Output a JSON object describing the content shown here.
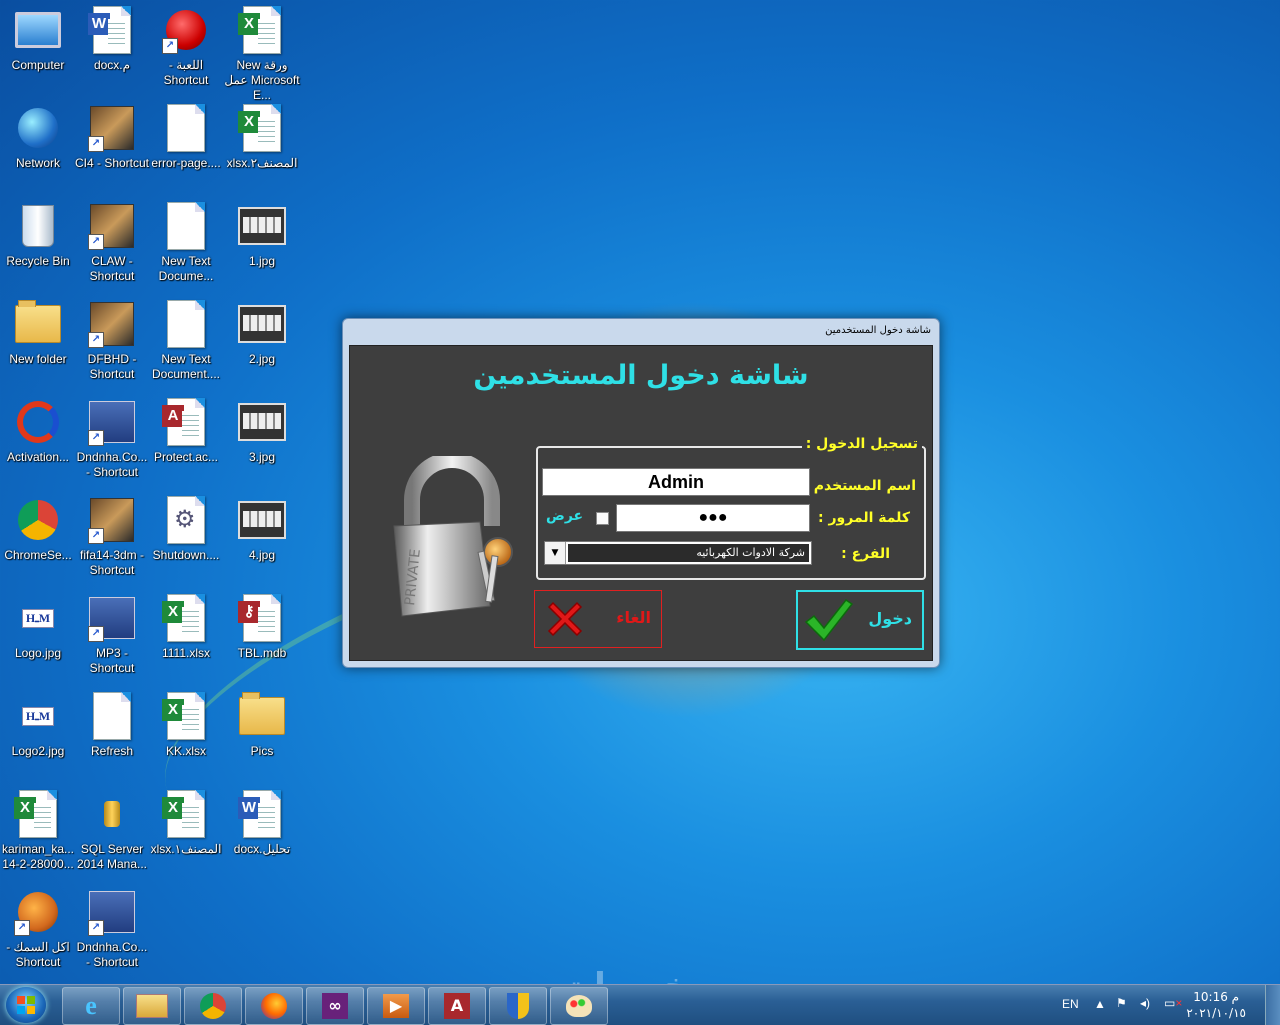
{
  "desktop_icons": [
    {
      "label": "Computer",
      "icon": "computer-icon"
    },
    {
      "label": "م.docx",
      "icon": "word-doc-icon"
    },
    {
      "label": "اللعبة - Shortcut",
      "icon": "red-creature-game-icon"
    },
    {
      "label": "New ورقة عمل Microsoft E...",
      "icon": "excel-icon"
    },
    {
      "label": "Network",
      "icon": "network-globe-icon"
    },
    {
      "label": "CI4 - Shortcut",
      "icon": "game-art-icon"
    },
    {
      "label": "error-page....",
      "icon": "blank-doc-icon"
    },
    {
      "label": "المصنف٢.xlsx",
      "icon": "excel-icon"
    },
    {
      "label": "Recycle Bin",
      "icon": "recycle-bin-icon"
    },
    {
      "label": "CLAW - Shortcut",
      "icon": "claw-game-icon"
    },
    {
      "label": "New Text Docume...",
      "icon": "text-doc-icon"
    },
    {
      "label": "1.jpg",
      "icon": "jpg-thumbnail-icon"
    },
    {
      "label": "New folder",
      "icon": "folder-icon"
    },
    {
      "label": "DFBHD - Shortcut",
      "icon": "soldier-game-icon"
    },
    {
      "label": "New Text Document....",
      "icon": "text-doc-icon"
    },
    {
      "label": "2.jpg",
      "icon": "jpg-thumbnail-icon"
    },
    {
      "label": "Activation...",
      "icon": "activation-swirl-icon"
    },
    {
      "label": "Dndnha.Co... - Shortcut",
      "icon": "dndnha-shortcut-icon"
    },
    {
      "label": "Protect.ac...",
      "icon": "access-doc-icon"
    },
    {
      "label": "3.jpg",
      "icon": "jpg-thumbnail-icon"
    },
    {
      "label": "ChromeSe...",
      "icon": "chrome-setup-icon"
    },
    {
      "label": "fifa14-3dm - Shortcut",
      "icon": "fifa-game-icon"
    },
    {
      "label": "Shutdown....",
      "icon": "gear-doc-icon"
    },
    {
      "label": "4.jpg",
      "icon": "jpg-thumbnail-icon"
    },
    {
      "label": "Logo.jpg",
      "icon": "logo-image-icon"
    },
    {
      "label": "MP3 - Shortcut",
      "icon": "mp3-book-icon"
    },
    {
      "label": "1111.xlsx",
      "icon": "excel-icon"
    },
    {
      "label": "TBL.mdb",
      "icon": "mdb-doc-icon"
    },
    {
      "label": "Logo2.jpg",
      "icon": "logo-image-icon"
    },
    {
      "label": "Refresh",
      "icon": "refresh-doc-icon"
    },
    {
      "label": "KK.xlsx",
      "icon": "excel-icon"
    },
    {
      "label": "Pics",
      "icon": "folder-icon"
    },
    {
      "label": "kariman_ka... 14-2-28000...",
      "icon": "excel-icon"
    },
    {
      "label": "SQL Server 2014 Mana...",
      "icon": "sql-server-icon"
    },
    {
      "label": "المصنف١.xlsx",
      "icon": "excel-icon"
    },
    {
      "label": "تحليل.docx",
      "icon": "word-doc-icon"
    },
    {
      "label": "اكل السمك - Shortcut",
      "icon": "fish-game-icon"
    },
    {
      "label": "Dndnha.Co... - Shortcut",
      "icon": "dndnha-shortcut-icon"
    }
  ],
  "dialog": {
    "title": "شاشة دخول المستخدمين",
    "heading": "شاشة دخول المستخدمين",
    "group_caption": "تسجيل الدخول :",
    "username_label": "اسم المستخدم :",
    "username_value": "Admin",
    "password_label": "كلمة المرور :",
    "password_value": "●●●",
    "show_label": "عرض",
    "branch_label": "الفرع :",
    "branch_value": "شركة الادوات الكهربائيه",
    "padlock_text": "PRIVATE",
    "cancel_label": "الغاء",
    "login_label": "دخول"
  },
  "taskbar": {
    "apps": [
      "internet-explorer-icon",
      "file-explorer-icon",
      "chrome-icon",
      "firefox-icon",
      "visual-studio-icon",
      "media-player-icon",
      "access-icon",
      "security-shield-icon",
      "paint-icon"
    ],
    "language": "EN",
    "time": "10:16 م",
    "date": "٢٠٢١/١٠/١٥"
  },
  "watermark": "خمسات",
  "colors": {
    "heading": "#2fe0e6",
    "label": "#ffff28",
    "dialog_bg": "#3e3e3e",
    "cancel_border": "#e02020"
  }
}
